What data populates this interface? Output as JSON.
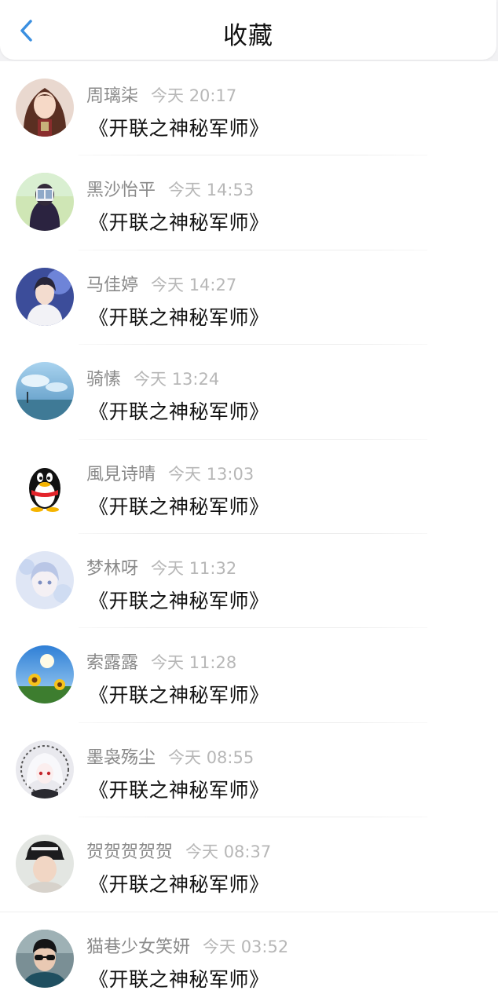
{
  "header": {
    "title": "收藏",
    "back_icon": "chevron-left-icon",
    "accent": "#3a8fe0"
  },
  "items": [
    {
      "name": "周璃柒",
      "time": "今天 20:17",
      "book": "《开联之神秘军师》",
      "avatar": "anime-girl-avatar"
    },
    {
      "name": "黑沙怡平",
      "time": "今天 14:53",
      "book": "《开联之神秘军师》",
      "avatar": "photo-girl-avatar"
    },
    {
      "name": "马佳婷",
      "time": "今天 14:27",
      "book": "《开联之神秘军师》",
      "avatar": "anime-boy-avatar"
    },
    {
      "name": "骑愫",
      "time": "今天 13:24",
      "book": "《开联之神秘军师》",
      "avatar": "sky-scenery-avatar"
    },
    {
      "name": "風見诗晴",
      "time": "今天 13:03",
      "book": "《开联之神秘军师》",
      "avatar": "penguin-avatar"
    },
    {
      "name": "梦林呀",
      "time": "今天 11:32",
      "book": "《开联之神秘军师》",
      "avatar": "pastel-anime-avatar"
    },
    {
      "name": "索露露",
      "time": "今天 11:28",
      "book": "《开联之神秘军师》",
      "avatar": "sunflower-avatar"
    },
    {
      "name": "墨袅殇尘",
      "time": "今天 08:55",
      "book": "《开联之神秘军师》",
      "avatar": "white-hair-anime-avatar"
    },
    {
      "name": "贺贺贺贺贺",
      "time": "今天 08:37",
      "book": "《开联之神秘军师》",
      "avatar": "boy-hat-avatar"
    },
    {
      "name": "猫巷少女笑妍",
      "time": "今天 03:52",
      "book": "《开联之神秘军师》",
      "avatar": "sunglasses-boy-avatar"
    }
  ]
}
